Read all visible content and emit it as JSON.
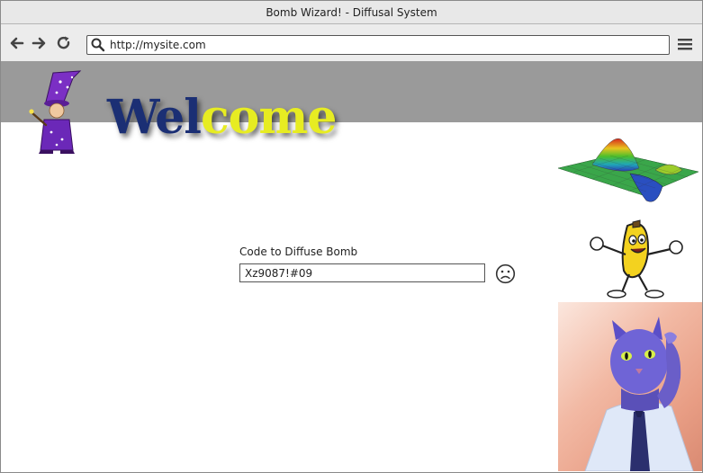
{
  "window": {
    "title": "Bomb Wizard! - Diffusal System"
  },
  "toolbar": {
    "back_icon": "back-arrow-icon",
    "forward_icon": "forward-arrow-icon",
    "reload_icon": "reload-icon",
    "url": "http://mysite.com",
    "menu_icon": "hamburger-menu-icon"
  },
  "header": {
    "welcome_part1": "Wel",
    "welcome_part2": "come",
    "colors": {
      "banner": "#9a9a9a",
      "welcome_dark": "#1b2f74",
      "welcome_light": "#e7ec22"
    }
  },
  "form": {
    "label": "Code to Diffuse Bomb",
    "code_value": "Xz9087!#09",
    "status_icon": "sad-face-icon"
  },
  "images": [
    "wizard-clipart",
    "3d-surface-plot",
    "dancing-banana",
    "cat-photo"
  ]
}
